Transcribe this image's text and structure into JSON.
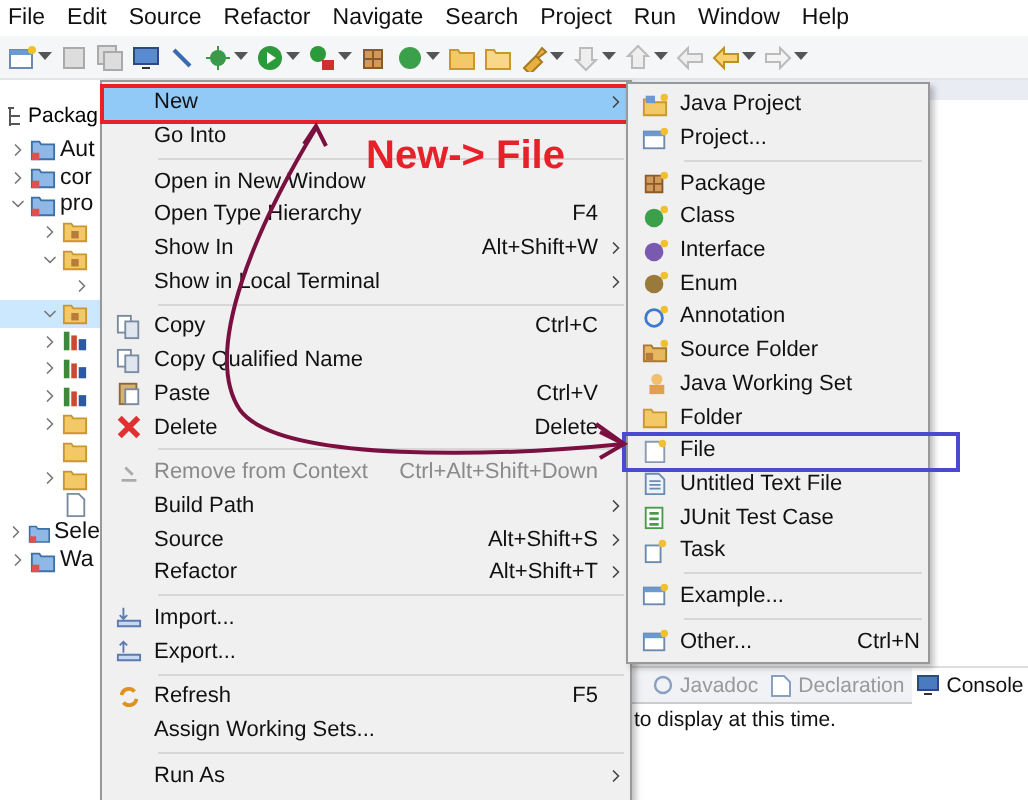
{
  "menubar": [
    "File",
    "Edit",
    "Source",
    "Refactor",
    "Navigate",
    "Search",
    "Project",
    "Run",
    "Window",
    "Help"
  ],
  "package_explorer": {
    "tab": "Packag",
    "tree": [
      {
        "label": "Aut",
        "kind": "project",
        "expanded": false
      },
      {
        "label": "cor",
        "kind": "project",
        "expanded": false
      },
      {
        "label": "pro",
        "kind": "project",
        "expanded": true,
        "children": [
          {
            "kind": "package",
            "expanded": false,
            "selected": false
          },
          {
            "kind": "package",
            "expanded": true,
            "selected": false,
            "children": [
              {
                "expanded": false
              }
            ]
          },
          {
            "kind": "package",
            "expanded": true,
            "selected": true
          },
          {
            "kind": "library",
            "expanded": false,
            "selected": false
          },
          {
            "kind": "library",
            "expanded": false,
            "selected": false
          },
          {
            "kind": "library",
            "expanded": false,
            "selected": false
          },
          {
            "kind": "folder",
            "expanded": false,
            "selected": false
          },
          {
            "kind": "folder",
            "selected": false
          },
          {
            "kind": "folder",
            "expanded": false,
            "selected": false
          },
          {
            "kind": "file",
            "selected": false
          }
        ]
      },
      {
        "label": "Sele",
        "kind": "project",
        "expanded": false
      },
      {
        "label": "Wa",
        "kind": "project",
        "expanded": false
      }
    ]
  },
  "context_menu": [
    {
      "kind": "item",
      "label": "New",
      "submenu": true,
      "selected": true,
      "disabled": false,
      "boxed": true
    },
    {
      "kind": "item",
      "label": "Go Into",
      "selected": false,
      "disabled": false
    },
    {
      "kind": "separator"
    },
    {
      "kind": "item",
      "label": "Open in New Window",
      "selected": false,
      "disabled": false
    },
    {
      "kind": "item",
      "label": "Open Type Hierarchy",
      "shortcut": "F4",
      "selected": false,
      "disabled": false
    },
    {
      "kind": "item",
      "label": "Show In",
      "shortcut": "Alt+Shift+W",
      "submenu": true,
      "selected": false,
      "disabled": false
    },
    {
      "kind": "item",
      "label": "Show in Local Terminal",
      "submenu": true,
      "selected": false,
      "disabled": false
    },
    {
      "kind": "separator"
    },
    {
      "kind": "item",
      "label": "Copy",
      "shortcut": "Ctrl+C",
      "selected": false,
      "disabled": false
    },
    {
      "kind": "item",
      "label": "Copy Qualified Name",
      "selected": false,
      "disabled": false
    },
    {
      "kind": "item",
      "label": "Paste",
      "shortcut": "Ctrl+V",
      "selected": false,
      "disabled": false
    },
    {
      "kind": "item",
      "label": "Delete",
      "shortcut": "Delete",
      "selected": false,
      "disabled": false
    },
    {
      "kind": "separator"
    },
    {
      "kind": "item",
      "label": "Remove from Context",
      "shortcut": "Ctrl+Alt+Shift+Down",
      "selected": false,
      "disabled": true
    },
    {
      "kind": "item",
      "label": "Build Path",
      "submenu": true,
      "selected": false,
      "disabled": false
    },
    {
      "kind": "item",
      "label": "Source",
      "shortcut": "Alt+Shift+S",
      "submenu": true,
      "selected": false,
      "disabled": false
    },
    {
      "kind": "item",
      "label": "Refactor",
      "shortcut": "Alt+Shift+T",
      "submenu": true,
      "selected": false,
      "disabled": false
    },
    {
      "kind": "separator"
    },
    {
      "kind": "item",
      "label": "Import...",
      "selected": false,
      "disabled": false
    },
    {
      "kind": "item",
      "label": "Export...",
      "selected": false,
      "disabled": false
    },
    {
      "kind": "separator"
    },
    {
      "kind": "item",
      "label": "Refresh",
      "shortcut": "F5",
      "selected": false,
      "disabled": false
    },
    {
      "kind": "item",
      "label": "Assign Working Sets...",
      "selected": false,
      "disabled": false
    },
    {
      "kind": "separator"
    },
    {
      "kind": "item",
      "label": "Run As",
      "submenu": true,
      "selected": false,
      "disabled": false
    }
  ],
  "new_submenu": [
    {
      "kind": "item",
      "label": "Java Project",
      "boxed": false
    },
    {
      "kind": "item",
      "label": "Project...",
      "boxed": false
    },
    {
      "kind": "separator"
    },
    {
      "kind": "item",
      "label": "Package",
      "boxed": false
    },
    {
      "kind": "item",
      "label": "Class",
      "boxed": false
    },
    {
      "kind": "item",
      "label": "Interface",
      "boxed": false
    },
    {
      "kind": "item",
      "label": "Enum",
      "boxed": false
    },
    {
      "kind": "item",
      "label": "Annotation",
      "boxed": false
    },
    {
      "kind": "item",
      "label": "Source Folder",
      "boxed": false
    },
    {
      "kind": "item",
      "label": "Java Working Set",
      "boxed": false
    },
    {
      "kind": "item",
      "label": "Folder",
      "boxed": false
    },
    {
      "kind": "item",
      "label": "File",
      "boxed": true
    },
    {
      "kind": "item",
      "label": "Untitled Text File",
      "boxed": false
    },
    {
      "kind": "item",
      "label": "JUnit Test Case",
      "boxed": false
    },
    {
      "kind": "item",
      "label": "Task",
      "boxed": false
    },
    {
      "kind": "separator"
    },
    {
      "kind": "item",
      "label": "Example...",
      "boxed": false
    },
    {
      "kind": "separator"
    },
    {
      "kind": "item",
      "label": "Other...",
      "shortcut": "Ctrl+N",
      "boxed": false
    }
  ],
  "annotation": {
    "label": "New-> File"
  },
  "console_view": {
    "tabs": [
      {
        "label": "Javadoc",
        "selected": false
      },
      {
        "label": "Declaration",
        "selected": false
      },
      {
        "label": "Console",
        "selected": true
      }
    ],
    "message": "to display at this time."
  }
}
